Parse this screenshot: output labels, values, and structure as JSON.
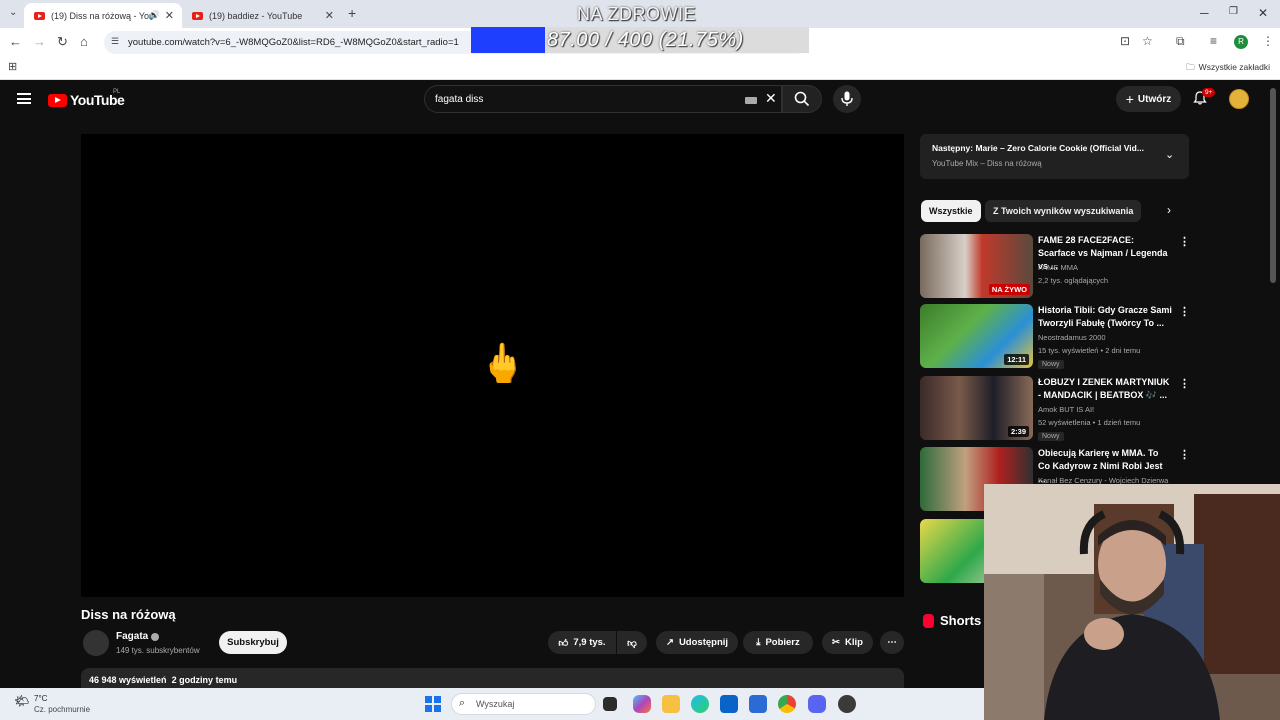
{
  "browser": {
    "tabs": [
      {
        "label": "(19) Diss na różową - YouTube",
        "active": true
      },
      {
        "label": "(19) baddiez - YouTube",
        "active": false
      }
    ],
    "url": "youtube.com/watch?v=6_-W8MQGoZ0&list=RD6_-W8MQGoZ0&start_radio=1",
    "all_bookmarks": "Wszystkie zakładki",
    "profile_initial": "R"
  },
  "stream_overlay": {
    "title": "NA ZDROWIE",
    "goal_text": "87.00 / 400 (21.75%)",
    "progress": 0.2175
  },
  "youtube": {
    "logo": "YouTube",
    "country": "PL",
    "search_value": "fagata diss",
    "create_label": "Utwórz",
    "notification_count": "9+",
    "video": {
      "title": "Diss na różową",
      "overlay_emoji": "🖕",
      "channel": "Fagata",
      "subscribers": "149 tys. subskrybentów",
      "subscribe_label": "Subskrybuj",
      "likes": "7,9 tys.",
      "share_label": "Udostępnij",
      "download_label": "Pobierz",
      "clip_label": "Klip",
      "views": "46 948 wyświetleń",
      "age": "2 godziny temu"
    },
    "next": {
      "title": "Następny: Marie – Zero Calorie Cookie (Official Vid...",
      "subtitle": "YouTube Mix – Diss na różową"
    },
    "chips": [
      "Wszystkie",
      "Z Twoich wyników wyszukiwania"
    ],
    "related": [
      {
        "title": "FAME 28 FACE2FACE: Scarface vs Najman / Legenda vs ...",
        "channel": "FAME MMA",
        "meta": "2,2 tys. oglądających",
        "badge": "NA ŻYWO",
        "new": ""
      },
      {
        "title": "Historia Tibii: Gdy Gracze Sami Tworzyli Fabułę (Twórcy To ...",
        "channel": "Neostradamus 2000",
        "meta": "15 tys. wyświetleń • 2 dni temu",
        "badge": "12:11",
        "new": "Nowy"
      },
      {
        "title": "ŁOBUZY I ZENEK MARTYNIUK - MANDACIK | BEATBOX 🎶 ...",
        "channel": "Amok BUT IS AI!",
        "meta": "52 wyświetlenia • 1 dzień temu",
        "badge": "2:39",
        "new": "Nowy"
      },
      {
        "title": "Obiecują Karierę w MMA. To Co Kadyrow z Nimi Robi Jest ...",
        "channel": "Kanał Bez Cenzury - Wojciech Dzierwa",
        "meta": "",
        "badge": "",
        "new": ""
      }
    ],
    "shorts_label": "Shorts"
  },
  "taskbar": {
    "weather_temp": "7°C",
    "weather_desc": "Cz. pochmurnie",
    "search_placeholder": "Wyszukaj"
  },
  "colors": {
    "yt_bg": "#0f0f0f",
    "yt_red": "#ff0000",
    "goal_fill": "#1f3fff"
  }
}
